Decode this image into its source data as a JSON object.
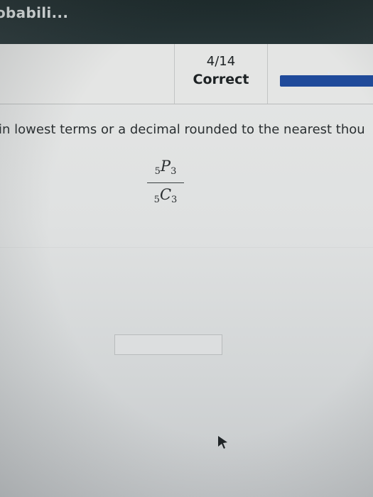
{
  "app": {
    "title": "obabili..."
  },
  "progress": {
    "count": "4/14",
    "status": "Correct",
    "fraction_complete": 0.2857,
    "fill_color": "#1f4a9a"
  },
  "question": {
    "instructions": "in lowest terms or a decimal rounded to the nearest thou",
    "numerator": {
      "pre_subscript": "5",
      "symbol": "P",
      "post_subscript": "3"
    },
    "denominator": {
      "pre_subscript": "5",
      "symbol": "C",
      "post_subscript": "3"
    }
  },
  "answer": {
    "value": ""
  },
  "icons": {
    "cursor": "mouse-pointer-icon"
  }
}
